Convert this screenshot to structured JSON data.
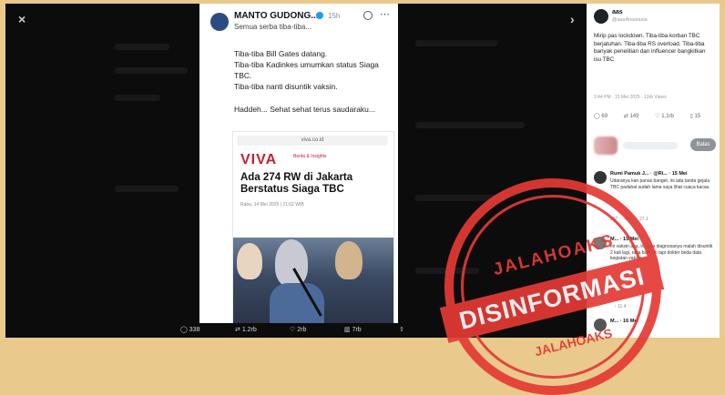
{
  "tweet": {
    "author": "MANTO GUDONG...",
    "time": "15h",
    "lead": "Semua serba tiba-tiba...",
    "paragraphs": [
      "Tiba-tiba Bill Gates datang.",
      "Tiba-tiba Kadinkes umumkan status Siaga TBC.",
      "Tiba-tiba nanti disuntik vaksin.",
      "Haddeh... Sehat sehat terus saudaraku..."
    ],
    "article": {
      "address": "viva.co.id",
      "brand": "VIVA",
      "brand_sub": "Berita & Insights",
      "headline": "Ada 274 RW di Jakarta Berstatus Siaga TBC",
      "meta": "Rabu, 14 Mei 2025 | 21:02 WIB"
    },
    "actions": {
      "replies": "338",
      "reposts": "1.2rb",
      "likes": "2rb",
      "views": "7rb"
    }
  },
  "side_post": {
    "name": "aas",
    "handle": "@aasAnastasia",
    "text": "Mirip pas lockdown. Tiba-tiba korban TBC berjatuhan. Tiba-tiba RS overload. Tiba-tiba banyak penelitian dan influencer bangkitkan isu TBC",
    "time": "2:44 PM · 15 Mei 2025 · 13rb Views",
    "stats": {
      "replies": "69",
      "reposts": "149",
      "likes": "1,1rb",
      "bookmarks": "15"
    },
    "reply_button": "Balas",
    "replies": [
      {
        "name": "Rumi Pamuk J... · @Ri... · 15 Mei",
        "text": "Udaranya kan panas banget, ini ada tanda gejala TBC padahal sudah lama saya lihat cuaca kacau.",
        "stats": "207  ♡ 482    ↑ 27.1"
      },
      {
        "name": "M... · 15 Mei",
        "text": "Ini vaksin apa, ini kata diagnosanya malah disuntik 2 kali lagi, rasa baik sih tapi dokter beda data kegiatan vaksin.",
        "stats": "   ↑ 11.4"
      },
      {
        "name": "M... · 16 Mei",
        "text": "",
        "stats": ""
      }
    ]
  },
  "stamp": {
    "top": "JALAHOAKS",
    "main": "DISINFORMASI",
    "bottom": "JALAHOAKS"
  },
  "colors": {
    "stamp_red": "#e43a35",
    "viva_red": "#c3212a",
    "frame_bg": "#0c0c0d",
    "border_beige": "#e9c98c"
  }
}
